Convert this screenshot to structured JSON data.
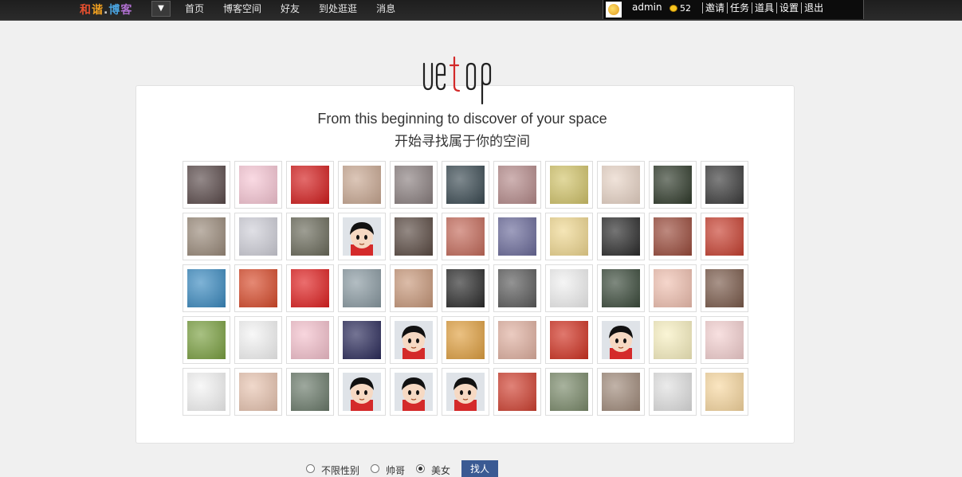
{
  "topbar": {
    "logo_parts": [
      "和",
      "谐",
      ".",
      "博",
      "客"
    ],
    "dropdown_glyph": "▼",
    "nav": [
      "首页",
      "博客空间",
      "好友",
      "到处逛逛",
      "消息"
    ],
    "username": "admin",
    "coins": "52",
    "user_links": [
      "邀请",
      "任务",
      "道具",
      "设置",
      "退出"
    ]
  },
  "brand": "uetop",
  "tagline_en": "From this beginning to discover of your space",
  "tagline_cn": "开始寻找属于你的空间",
  "avatars": [
    "#5a4a4a",
    "#f7c6d4",
    "#d41c1c",
    "#c9a892",
    "#8a7f7f",
    "#3a4a52",
    "#b58a8a",
    "#d2c46a",
    "#e8d4c6",
    "#2f3a2a",
    "#3a3a3a",
    "#9a8a7a",
    "#cfcfd8",
    "#6a6a5a",
    "cartoon",
    "#5a4a42",
    "#c46a5a",
    "#6a6a9a",
    "#f0d890",
    "#2a2a2a",
    "#9a4a3a",
    "#c84030",
    "#3a8ac0",
    "#d84a2a",
    "#e02020",
    "#8a9aa2",
    "#c8987a",
    "#2a2a2a",
    "#5a5a5a",
    "#f0f0f0",
    "#3a4a3a",
    "#f0c0b0",
    "#7a5a4a",
    "#7aa040",
    "#f4f4f4",
    "#f4c0cc",
    "#2a2a5a",
    "cartoon",
    "#e0a040",
    "#e0b0a0",
    "#d03020",
    "cartoon",
    "#f8f0c0",
    "#f4d0d0",
    "#f4f4f4",
    "#e8c4b0",
    "#6a7a6a",
    "cartoon",
    "cartoon",
    "cartoon",
    "#d04030",
    "#7a8a6a",
    "#a08a7a",
    "#e0e0e0",
    "#f8d8a0"
  ],
  "filters": {
    "options": [
      "不限性别",
      "帅哥",
      "美女"
    ],
    "selected": 2,
    "button": "找人"
  }
}
